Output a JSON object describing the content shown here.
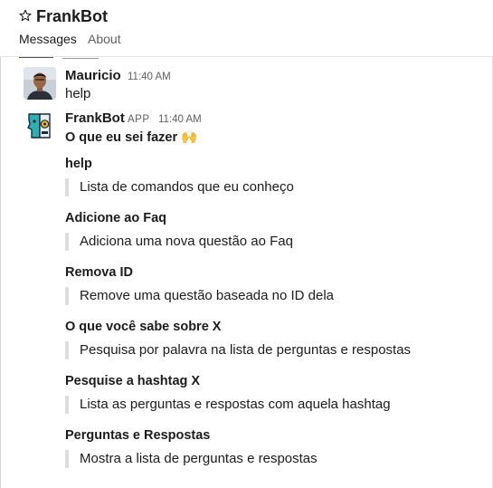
{
  "header": {
    "channel_name": "FrankBot",
    "tabs": [
      "Messages",
      "About"
    ]
  },
  "messages": [
    {
      "sender": "Mauricio",
      "time": "11:40 AM",
      "text": "help"
    },
    {
      "sender": "FrankBot",
      "badge": "APP",
      "time": "11:40 AM",
      "text": "O que eu sei fazer 🙌",
      "sections": [
        {
          "title": "help",
          "description": "Lista de comandos que eu conheço"
        },
        {
          "title": "Adicione ao Faq",
          "description": "Adiciona uma nova questão ao Faq"
        },
        {
          "title": "Remova ID",
          "description": "Remove uma questão baseada no ID dela"
        },
        {
          "title": "O que você sabe sobre X",
          "description": "Pesquisa por palavra na lista de perguntas e respostas"
        },
        {
          "title": "Pesquise a hashtag X",
          "description": "Lista as perguntas e respostas com aquela hashtag"
        },
        {
          "title": "Perguntas e Respostas",
          "description": "Mostra a lista de perguntas e respostas"
        }
      ]
    }
  ]
}
